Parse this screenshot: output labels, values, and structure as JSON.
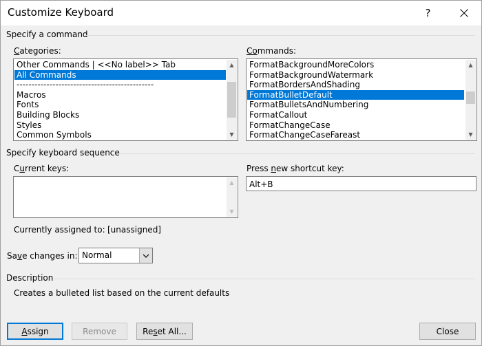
{
  "window": {
    "title": "Customize Keyboard",
    "help_label": "?"
  },
  "sections": {
    "specify_command": "Specify a command",
    "keyboard_sequence": "Specify keyboard sequence",
    "description": "Description"
  },
  "categories": {
    "label_underlined": "C",
    "label_rest": "ategories:",
    "items": [
      {
        "label": "Other Commands | <<No label>> Tab",
        "selected": false
      },
      {
        "label": "All Commands",
        "selected": true
      },
      {
        "label": "----------------------------------------------",
        "selected": false
      },
      {
        "label": "Macros",
        "selected": false
      },
      {
        "label": "Fonts",
        "selected": false
      },
      {
        "label": "Building Blocks",
        "selected": false
      },
      {
        "label": "Styles",
        "selected": false
      },
      {
        "label": "Common Symbols",
        "selected": false
      }
    ]
  },
  "commands": {
    "label_underlined": "Co",
    "label_rest": "mmands:",
    "items": [
      {
        "label": "FormatBackgroundMoreColors",
        "selected": false
      },
      {
        "label": "FormatBackgroundWatermark",
        "selected": false
      },
      {
        "label": "FormatBordersAndShading",
        "selected": false
      },
      {
        "label": "FormatBulletDefault",
        "selected": true
      },
      {
        "label": "FormatBulletsAndNumbering",
        "selected": false
      },
      {
        "label": "FormatCallout",
        "selected": false
      },
      {
        "label": "FormatChangeCase",
        "selected": false
      },
      {
        "label": "FormatChangeCaseFareast",
        "selected": false
      }
    ]
  },
  "current_keys": {
    "label_pre": "C",
    "label_underlined": "u",
    "label_rest": "rrent keys:",
    "value": ""
  },
  "new_shortcut": {
    "label_pre": "Press ",
    "label_underlined": "n",
    "label_rest": "ew shortcut key:",
    "value": "Alt+B"
  },
  "assigned": {
    "label": "Currently assigned to:",
    "value": "[unassigned]"
  },
  "save_changes": {
    "label_pre": "Sa",
    "label_underlined": "v",
    "label_rest": "e changes in:",
    "value": "Normal"
  },
  "description_text": "Creates a bulleted list based on the current defaults",
  "buttons": {
    "assign_underlined": "A",
    "assign_rest": "ssign",
    "remove": "Remove",
    "reset_pre": "Re",
    "reset_underlined": "s",
    "reset_rest": "et All...",
    "close": "Close"
  }
}
